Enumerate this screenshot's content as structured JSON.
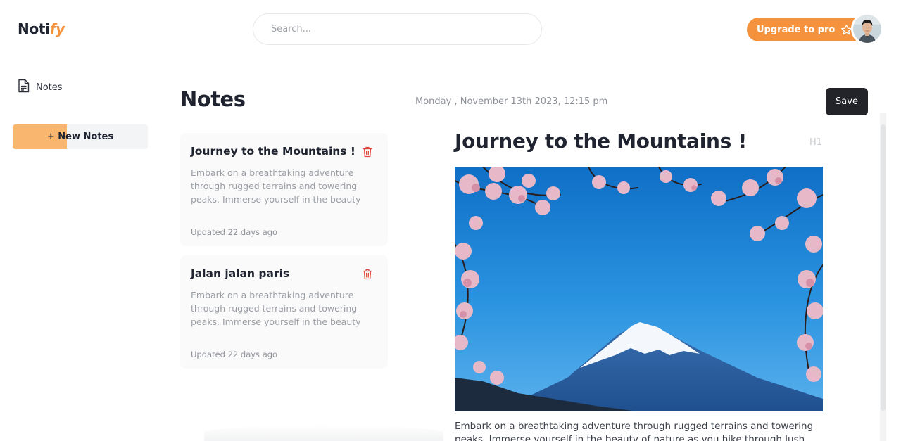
{
  "header": {
    "logo_main": "Noti",
    "logo_accent": "fy",
    "search_placeholder": "Search...",
    "upgrade_label": "Upgrade to pro",
    "accent_color": "#f5923e"
  },
  "sidebar": {
    "items": [
      {
        "label": "Notes",
        "icon": "document-icon"
      }
    ],
    "new_notes_label": "+ New Notes"
  },
  "main": {
    "title": "Notes",
    "date": "Monday , November 13th 2023, 12:15 pm",
    "save_label": "Save",
    "notes": [
      {
        "title": "Journey to the Mountains !",
        "excerpt": "Embark on a breathtaking adventure through rugged terrains and towering peaks. Immerse yourself in the beauty ...",
        "updated": "Updated 22 days ago"
      },
      {
        "title": "Jalan jalan paris",
        "excerpt": "Embark on a breathtaking adventure through rugged terrains and towering peaks. Immerse yourself in the beauty ...",
        "updated": "Updated 22 days ago"
      }
    ]
  },
  "editor": {
    "title": "Journey to the Mountains !",
    "heading_tag": "H1",
    "body": "Embark on a breathtaking adventure through rugged terrains and towering peaks. Immerse yourself in the beauty of nature as you hike through lush forests, cross"
  }
}
